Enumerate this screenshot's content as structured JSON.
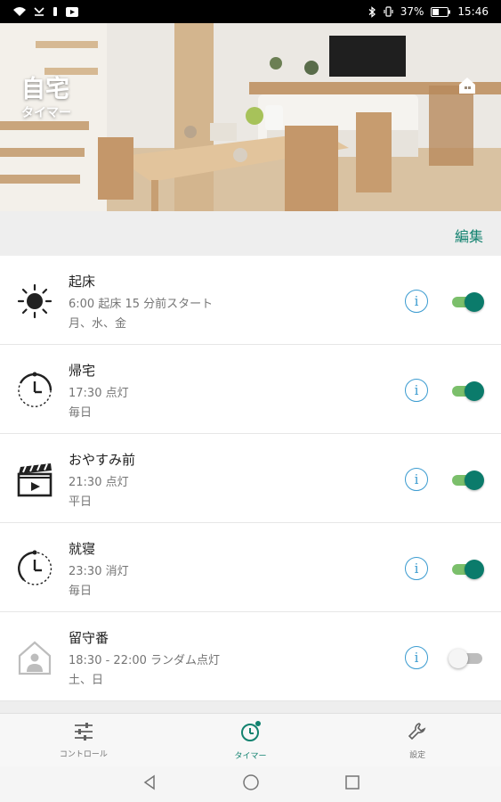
{
  "status_bar": {
    "battery_percent": "37%",
    "time": "15:46"
  },
  "header": {
    "title": "自宅",
    "subtitle": "タイマー"
  },
  "edit_label": "編集",
  "timers": [
    {
      "name": "起床",
      "time": "6:00 起床 15 分前スタート",
      "days": "月、水、金",
      "icon": "sun-icon",
      "enabled": true
    },
    {
      "name": "帰宅",
      "time": "17:30 点灯",
      "days": "毎日",
      "icon": "clock-arrival-icon",
      "enabled": true
    },
    {
      "name": "おやすみ前",
      "time": "21:30 点灯",
      "days": "平日",
      "icon": "clapperboard-icon",
      "enabled": true
    },
    {
      "name": "就寝",
      "time": "23:30 消灯",
      "days": "毎日",
      "icon": "clock-sleep-icon",
      "enabled": true
    },
    {
      "name": "留守番",
      "time": "18:30 - 22:00 ランダム点灯",
      "days": "土、日",
      "icon": "house-person-icon",
      "enabled": false
    }
  ],
  "bottom_nav": {
    "control": "コントロール",
    "timer": "タイマー",
    "settings": "設定",
    "active": "timer"
  },
  "colors": {
    "accent": "#12826f",
    "toggle_on_knob": "#0b7b6b",
    "toggle_on_track": "#7bbf6b",
    "info_icon": "#3a9bd0"
  }
}
